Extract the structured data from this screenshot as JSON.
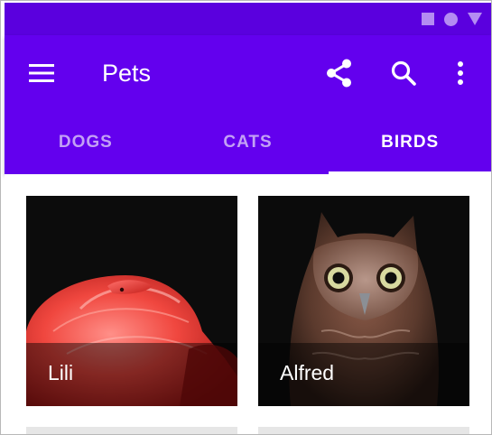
{
  "status_bar": {
    "icons": [
      "square-icon",
      "circle-icon",
      "triangle-icon"
    ],
    "color": "#5a00de"
  },
  "app_bar": {
    "title": "Pets",
    "color": "#6300ee",
    "actions": [
      "menu-icon",
      "share-icon",
      "search-icon",
      "more-vert-icon"
    ]
  },
  "tabs": [
    {
      "label": "DOGS",
      "selected": false
    },
    {
      "label": "CATS",
      "selected": false
    },
    {
      "label": "BIRDS",
      "selected": true
    }
  ],
  "grid": {
    "items": [
      {
        "name": "Lili"
      },
      {
        "name": "Alfred"
      }
    ]
  }
}
